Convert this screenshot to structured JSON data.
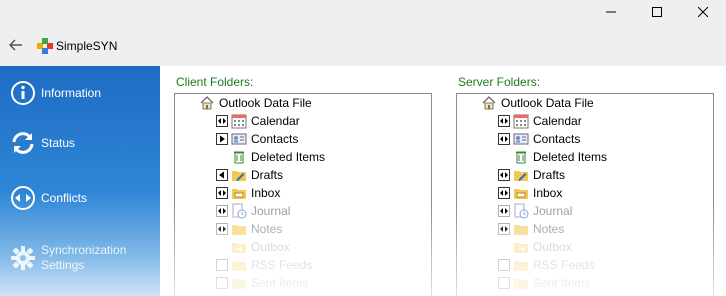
{
  "window": {
    "title": "SimpleSYN",
    "controls": [
      "minimize",
      "maximize",
      "close"
    ]
  },
  "sidebar": {
    "items": [
      {
        "label": "Information",
        "icon": "info-icon"
      },
      {
        "label": "Status",
        "icon": "sync-icon"
      },
      {
        "label": "Conflicts",
        "icon": "conflicts-icon"
      },
      {
        "label": "Synchronization Settings",
        "icon": "gear-icon"
      }
    ]
  },
  "client": {
    "title": "Client Folders:",
    "root": "Outlook Data File",
    "items": [
      {
        "label": "Calendar",
        "icon": "calendar-icon",
        "control": "both-arrows"
      },
      {
        "label": "Contacts",
        "icon": "contacts-icon",
        "control": "right-arrow"
      },
      {
        "label": "Deleted Items",
        "icon": "trash-icon",
        "control": "none"
      },
      {
        "label": "Drafts",
        "icon": "drafts-folder-icon",
        "control": "left-arrow"
      },
      {
        "label": "Inbox",
        "icon": "inbox-folder-icon",
        "control": "both-arrows"
      },
      {
        "label": "Journal",
        "icon": "journal-icon",
        "control": "both-arrows"
      },
      {
        "label": "Notes",
        "icon": "notes-folder-icon",
        "control": "both-arrows"
      },
      {
        "label": "Outbox",
        "icon": "outbox-icon",
        "control": "none"
      },
      {
        "label": "RSS Feeds",
        "icon": "folder-icon",
        "control": "checkbox"
      },
      {
        "label": "Sent Items",
        "icon": "sent-folder-icon",
        "control": "checkbox"
      }
    ]
  },
  "server": {
    "title": "Server Folders:",
    "root": "Outlook Data File",
    "items": [
      {
        "label": "Calendar",
        "icon": "calendar-icon",
        "control": "both-arrows"
      },
      {
        "label": "Contacts",
        "icon": "contacts-icon",
        "control": "both-arrows"
      },
      {
        "label": "Deleted Items",
        "icon": "trash-icon",
        "control": "none"
      },
      {
        "label": "Drafts",
        "icon": "drafts-folder-icon",
        "control": "both-arrows"
      },
      {
        "label": "Inbox",
        "icon": "inbox-folder-icon",
        "control": "both-arrows"
      },
      {
        "label": "Journal",
        "icon": "journal-icon",
        "control": "both-arrows"
      },
      {
        "label": "Notes",
        "icon": "notes-folder-icon",
        "control": "both-arrows"
      },
      {
        "label": "Outbox",
        "icon": "outbox-icon",
        "control": "none"
      },
      {
        "label": "RSS Feeds",
        "icon": "folder-icon",
        "control": "checkbox"
      },
      {
        "label": "Sent Items",
        "icon": "sent-folder-icon",
        "control": "checkbox"
      }
    ]
  },
  "colors": {
    "sidebar_top": "#1d6cc4",
    "pane_title": "#1f7a1f",
    "folder": "#f2c94c"
  }
}
